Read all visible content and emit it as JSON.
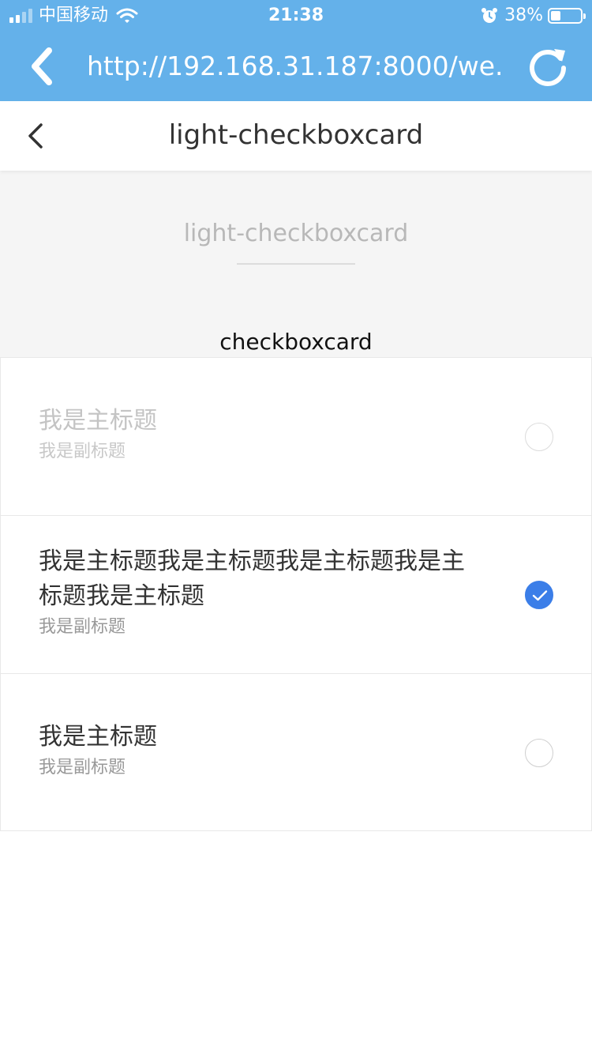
{
  "status_bar": {
    "carrier": "中国移动",
    "time": "21:38",
    "battery_percent": "38%",
    "signal_bars": 4,
    "signal_active": 2,
    "battery_level": 0.38,
    "icons": [
      "signal-icon",
      "wifi-icon",
      "alarm-icon",
      "battery-icon"
    ]
  },
  "browser": {
    "url": "http://192.168.31.187:8000/we...",
    "icons": [
      "back-chevron-icon",
      "refresh-icon"
    ]
  },
  "nav": {
    "title": "light-checkboxcard"
  },
  "page": {
    "heading": "light-checkboxcard",
    "section_label": "checkboxcard"
  },
  "cards": [
    {
      "title": "我是主标题",
      "subtitle": "我是副标题",
      "checked": false,
      "disabled": true
    },
    {
      "title": "我是主标题我是主标题我是主标题我是主标题我是主标题",
      "subtitle": "我是副标题",
      "checked": true,
      "disabled": false
    },
    {
      "title": "我是主标题",
      "subtitle": "我是副标题",
      "checked": false,
      "disabled": false
    }
  ],
  "colors": {
    "brand_blue": "#64b1ea",
    "check_blue": "#3b7ee8",
    "header_bg": "#f5f5f5"
  }
}
